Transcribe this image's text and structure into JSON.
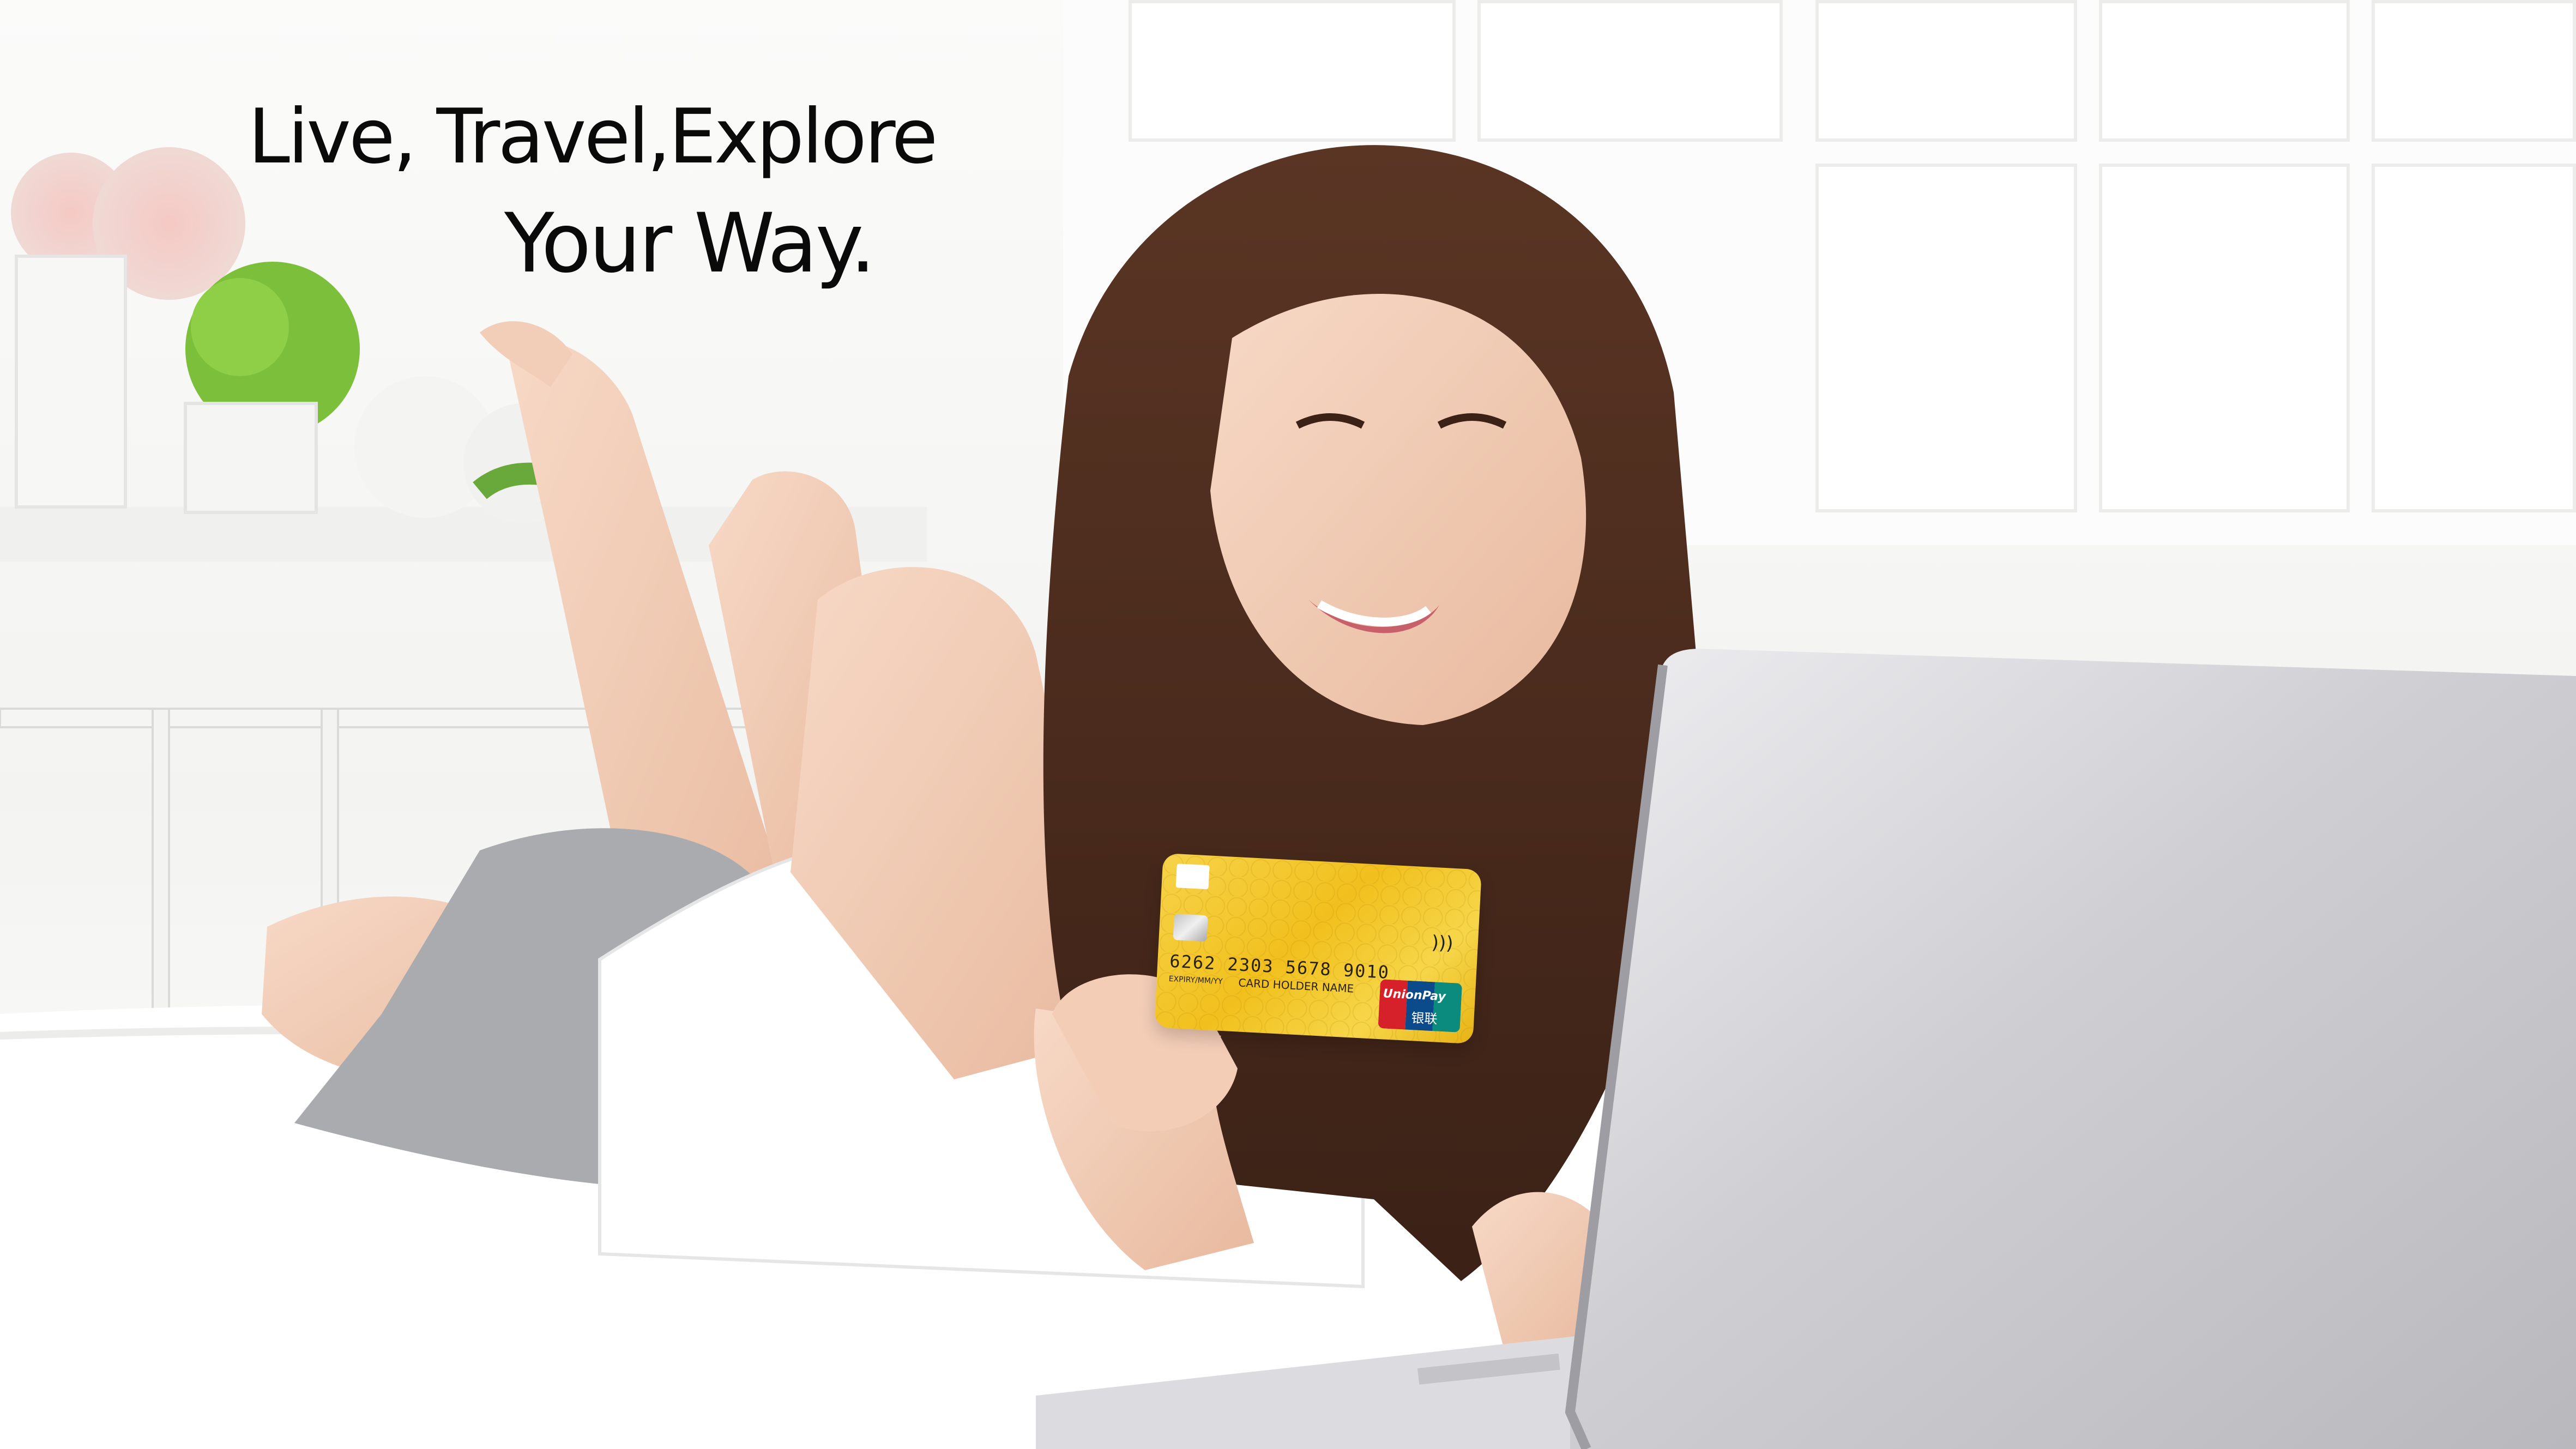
{
  "headline": {
    "line1": "Live, Travel,Explore",
    "line2": "Your Way."
  },
  "card": {
    "number": "6262 2303 5678 9010",
    "expiry_label": "EXPIRY/MM/YY",
    "holder": "CARD HOLDER NAME",
    "brand": "UnionPay",
    "brand_cn": "银联",
    "colors": {
      "gold": "#f1c01d",
      "red": "#d6212b",
      "blue": "#0b4a8b",
      "teal": "#0b8a7e"
    }
  },
  "icons": [
    "contactless-icon",
    "chip-icon",
    "unionpay-logo"
  ]
}
